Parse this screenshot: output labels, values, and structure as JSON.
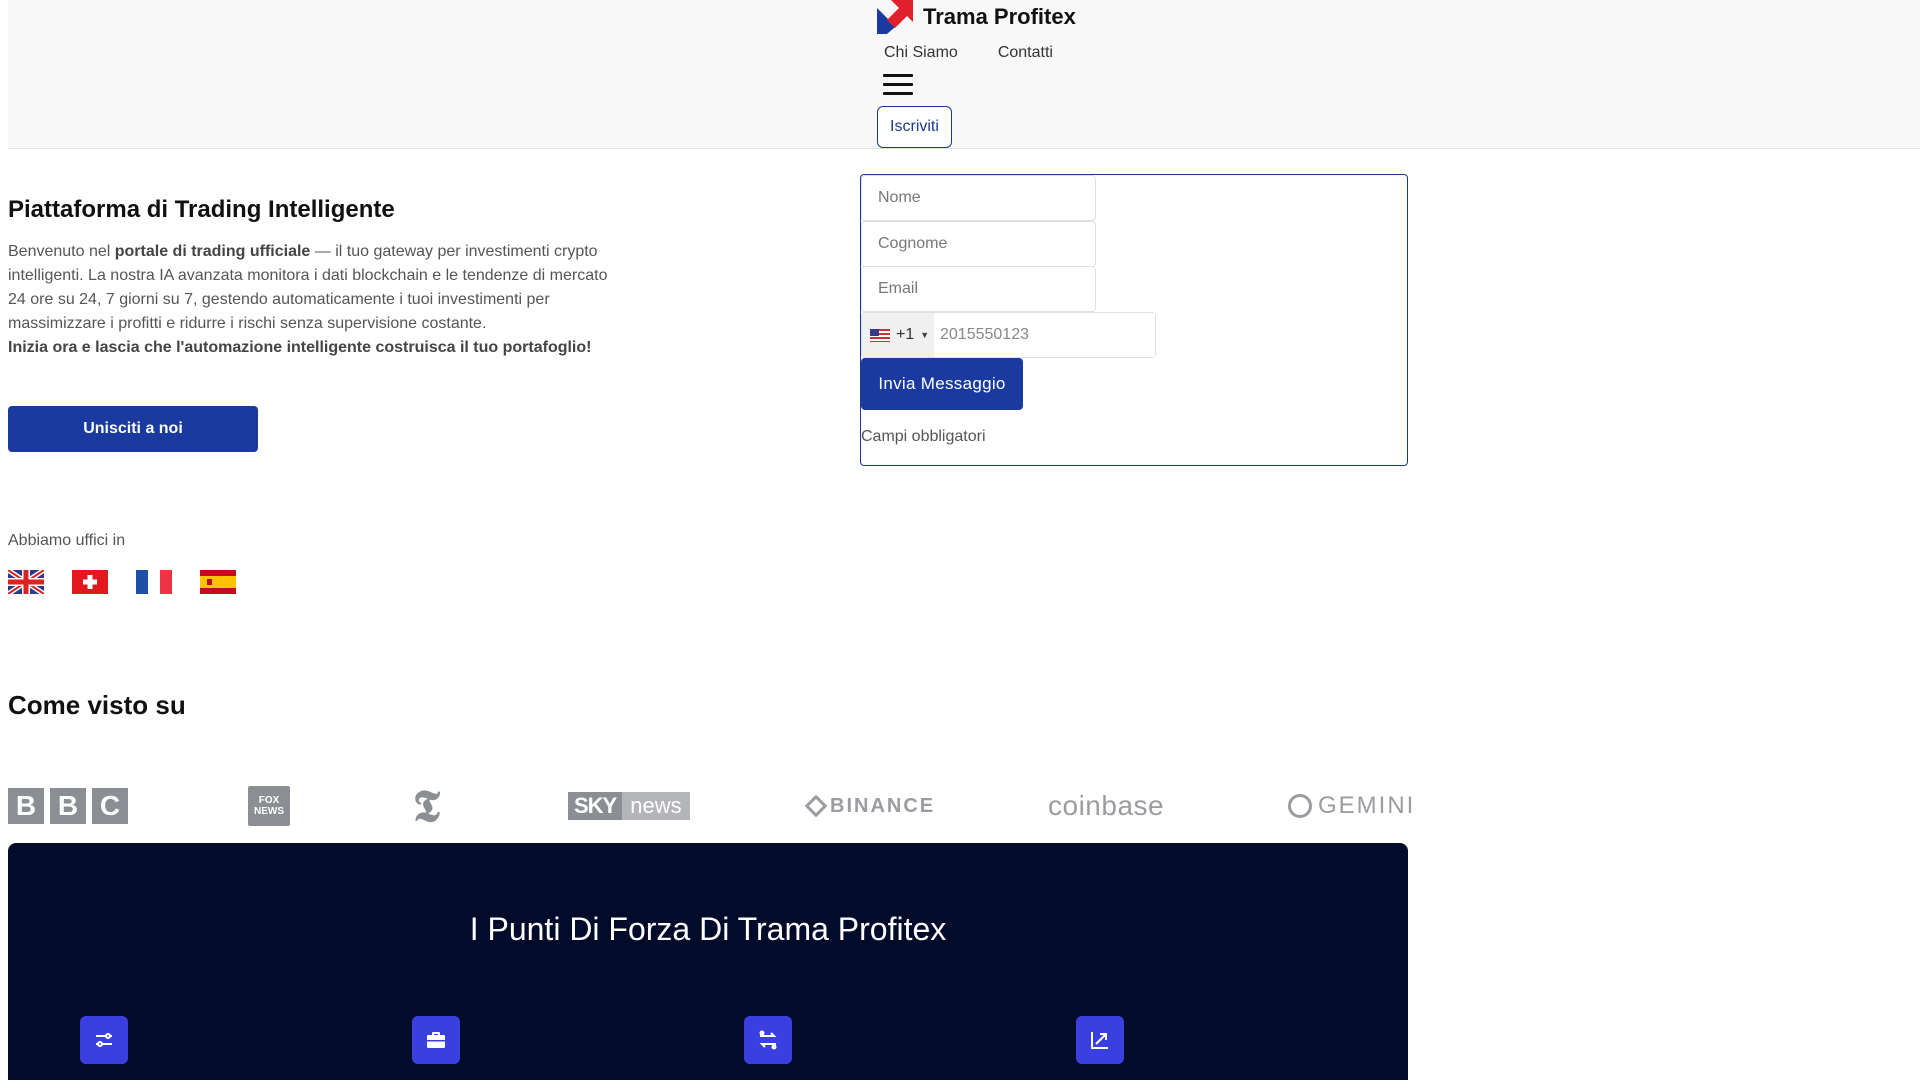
{
  "header": {
    "brand_name": "Trama Profitex",
    "nav": [
      "Chi Siamo",
      "Contatti"
    ],
    "signup_label": "Iscriviti"
  },
  "hero": {
    "title": "Piattaforma di Trading Intelligente",
    "text_1": "Benvenuto nel ",
    "text_bold_1": "portale di trading ufficiale",
    "text_2": " — il tuo gateway per investimenti crypto intelligenti. La nostra IA avanzata monitora i dati blockchain e le tendenze di mercato 24 ore su 24, 7 giorni su 7, gestendo automaticamente i tuoi investimenti per massimizzare i profitti e ridurre i rischi senza supervisione costante.",
    "text_bold_2": "Inizia ora e lascia che l'automazione intelligente costruisca il tuo portafoglio!",
    "join_label": "Unisciti a noi",
    "offices_label": "Abbiamo uffici in"
  },
  "form": {
    "first_name_placeholder": "Nome",
    "last_name_placeholder": "Cognome",
    "email_placeholder": "Email",
    "phone_code": "+1",
    "phone_placeholder": "2015550123",
    "submit_label": "Invia Messaggio",
    "required_note": "Campi obbligatori"
  },
  "seen_on": {
    "title": "Come visto su",
    "logos": {
      "bbc": [
        "B",
        "B",
        "C"
      ],
      "fox": [
        "FOX",
        "NEWS"
      ],
      "nyt": "𝕿",
      "sky_1": "SKY",
      "sky_2": "news",
      "binance": "BINANCE",
      "coinbase": "coinbase",
      "gemini": "GEMINI"
    }
  },
  "strengths": {
    "title": "I Punti Di Forza Di Trama Profitex"
  },
  "colors": {
    "primary": "#1a3aa0",
    "dark_section": "#030b2b",
    "feature_icon": "#3a3fe0"
  }
}
